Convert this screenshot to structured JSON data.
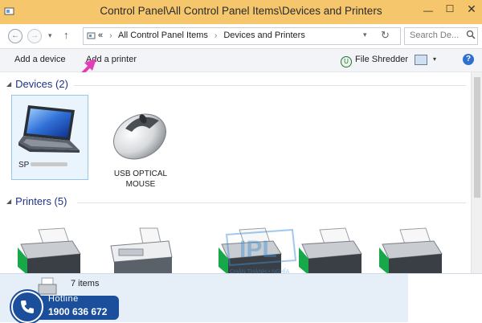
{
  "window": {
    "title": "Control Panel\\All Control Panel Items\\Devices and Printers"
  },
  "window_buttons": {
    "minimize": "—",
    "maximize": "☐",
    "close": "✕"
  },
  "address_bar": {
    "back_glyph": "←",
    "forward_glyph": "→",
    "up_glyph": "↑",
    "overflow": "«",
    "crumbs": [
      "All Control Panel Items",
      "Devices and Printers"
    ],
    "separator": "›",
    "dropdown_glyph": "▾",
    "refresh_glyph": "↻",
    "search_placeholder": "Search De..."
  },
  "command_bar": {
    "add_device": "Add a device",
    "add_printer": "Add a printer",
    "file_shredder": "File Shredder",
    "help": "?"
  },
  "groups": {
    "devices": {
      "header": "Devices (2)",
      "items": [
        {
          "label_prefix": "SP",
          "icon": "laptop-icon",
          "selected": true
        },
        {
          "label": "USB OPTICAL MOUSE",
          "icon": "mouse-icon"
        }
      ]
    },
    "printers": {
      "header": "Printers (5)",
      "count": 5
    }
  },
  "status": {
    "item_count": "7 items"
  },
  "hotline": {
    "label": "Hotline",
    "phone": "1900 636 672"
  },
  "watermark": {
    "logo_text": "IPL",
    "tagline": "CHÂN THÀNH • NGHĨA"
  },
  "colors": {
    "titlebar": "#f5c66c",
    "group_header": "#1e3287",
    "annotation_arrow": "#e23fb6",
    "hotline": "#1b4f9c"
  }
}
